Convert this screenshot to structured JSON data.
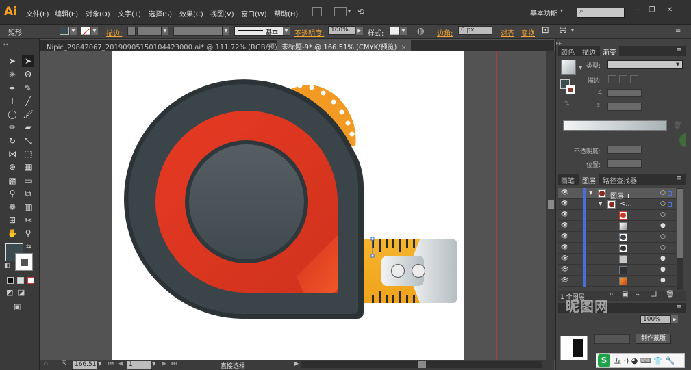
{
  "app": {
    "logo": "Ai"
  },
  "menu": {
    "items": [
      "文件(F)",
      "编辑(E)",
      "对象(O)",
      "文字(T)",
      "选择(S)",
      "效果(C)",
      "视图(V)",
      "窗口(W)",
      "帮助(H)"
    ],
    "workspace": "基本功能"
  },
  "control_bar": {
    "selection_type": "矩形",
    "stroke_label": "描边:",
    "stroke_style_label": "基本",
    "opacity_label": "不透明度:",
    "opacity_value": "100%",
    "style_label": "样式:",
    "corner_label": "边角:",
    "corner_value": "0 px",
    "align_label": "对齐",
    "transform_label": "变换"
  },
  "tabs": [
    {
      "label": "Nipic_29842067_20190905150104423000.ai* @ 111.72% (RGB/预览)",
      "active": false
    },
    {
      "label": "未标题-9* @ 166.51% (CMYK/预览)",
      "active": true
    }
  ],
  "status": {
    "zoom": "166.51",
    "page": "1",
    "current_tool": "直接选择"
  },
  "colors": {
    "fill": "#3b4b50",
    "accent_orange": "#f0a030",
    "guide": "#c03838",
    "layer_strip": "#4a6fd8"
  },
  "gradient_panel": {
    "tabs": [
      "颜色",
      "描边",
      "渐变"
    ],
    "active_tab": "渐变",
    "type_label": "类型:",
    "stroke_label": "描边:",
    "opacity_label": "不透明度:",
    "location_label": "位置:"
  },
  "layers_panel": {
    "tabs": [
      "画笔",
      "图层",
      "路径查找器"
    ],
    "active_tab": "图层",
    "layer_name": "图层 1",
    "group_name": "<...",
    "footer_count": "1 个图层"
  },
  "bottom_panel": {
    "opacity_value": "100%",
    "mask_button": "制作蒙版"
  },
  "overlay": {
    "watermark": "昵图网",
    "ime_logo": "S",
    "ime_text": "五 ·) ◕ ⌨ 👕 🔧"
  }
}
